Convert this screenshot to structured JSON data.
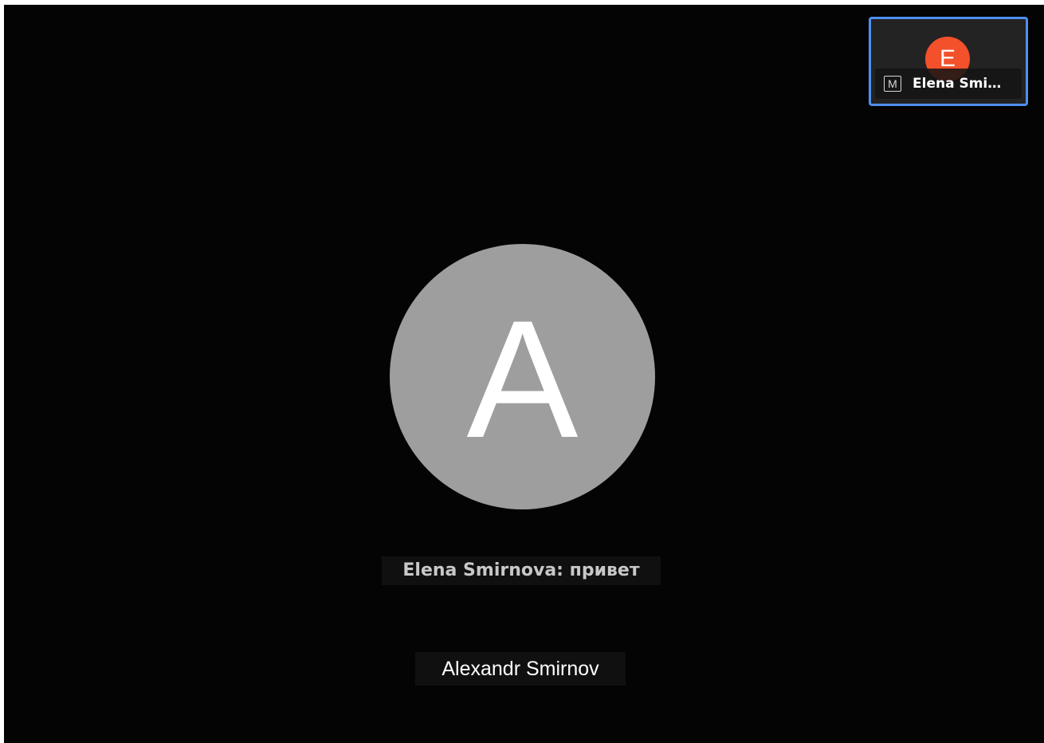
{
  "main_video": {
    "avatar_initial": "A",
    "avatar_color": "#9e9e9e",
    "participant_name": "Alexandr Smirnov",
    "caption": "Elena Smirnova: привет"
  },
  "thumbnail": {
    "avatar_initial": "E",
    "avatar_color": "#f2512b",
    "participant_name": "Elena Smi…",
    "mute_icon_glyph": "M",
    "active_border_color": "#4f8ff0"
  }
}
